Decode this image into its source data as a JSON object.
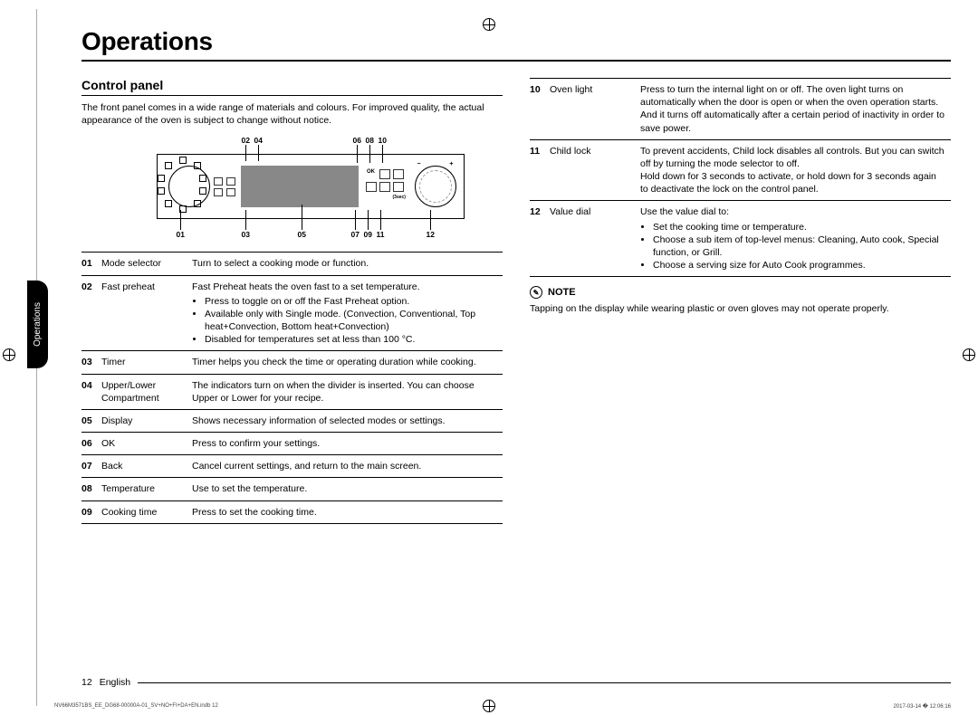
{
  "title": "Operations",
  "section": "Control panel",
  "intro": "The front panel comes in a wide range of materials and colours. For improved quality, the actual appearance of the oven is subject to change without notice.",
  "side_tab": "Operations",
  "diagram_labels": {
    "top": [
      "02",
      "04",
      "06",
      "08",
      "10"
    ],
    "bottom": [
      "01",
      "03",
      "05",
      "07",
      "09",
      "11",
      "12"
    ]
  },
  "items_left": [
    {
      "num": "01",
      "label": "Mode selector",
      "desc": "Turn to select a cooking mode or function."
    },
    {
      "num": "02",
      "label": "Fast preheat",
      "desc": "Fast Preheat heats the oven fast to a set temperature.",
      "bullets": [
        "Press to toggle on or off the Fast Preheat option.",
        "Available only with Single mode. (Convection, Conventional, Top heat+Convection, Bottom heat+Convection)",
        "Disabled for temperatures set at less than 100 °C."
      ]
    },
    {
      "num": "03",
      "label": "Timer",
      "desc": "Timer helps you check the time or operating duration while cooking."
    },
    {
      "num": "04",
      "label": "Upper/Lower Compartment",
      "desc": "The indicators turn on when the divider is inserted. You can choose Upper or Lower for your recipe."
    },
    {
      "num": "05",
      "label": "Display",
      "desc": "Shows necessary information of selected modes or settings."
    },
    {
      "num": "06",
      "label": "OK",
      "desc": "Press to confirm your settings."
    },
    {
      "num": "07",
      "label": "Back",
      "desc": "Cancel current settings, and return to the main screen."
    },
    {
      "num": "08",
      "label": "Temperature",
      "desc": "Use to set the temperature."
    },
    {
      "num": "09",
      "label": "Cooking time",
      "desc": "Press to set the cooking time."
    }
  ],
  "items_right": [
    {
      "num": "10",
      "label": "Oven light",
      "desc": "Press to turn the internal light on or off. The oven light turns on automatically when the door is open or when the oven operation starts. And it turns off automatically after a certain period of inactivity in order to save power."
    },
    {
      "num": "11",
      "label": "Child lock",
      "desc": "To prevent accidents, Child lock disables all controls. But you can switch off by turning the mode selector to off.\nHold down for 3 seconds to activate, or hold down for 3 seconds again to deactivate the lock on the control panel."
    },
    {
      "num": "12",
      "label": "Value dial",
      "desc": "Use the value dial to:",
      "bullets": [
        "Set the cooking time or temperature.",
        "Choose a sub item of top-level menus: Cleaning, Auto cook, Special function, or Grill.",
        "Choose a serving size for Auto Cook programmes."
      ]
    }
  ],
  "note_label": "NOTE",
  "note_text": "Tapping on the display while wearing plastic or oven gloves may not operate properly.",
  "footer": {
    "page": "12",
    "language": "English"
  },
  "slug": {
    "file": "NV66M3571BS_EE_DG68-00000A-01_SV+NO+FI+DA+EN.indb   12",
    "date": "2017-03-14   � 12:06:16"
  }
}
